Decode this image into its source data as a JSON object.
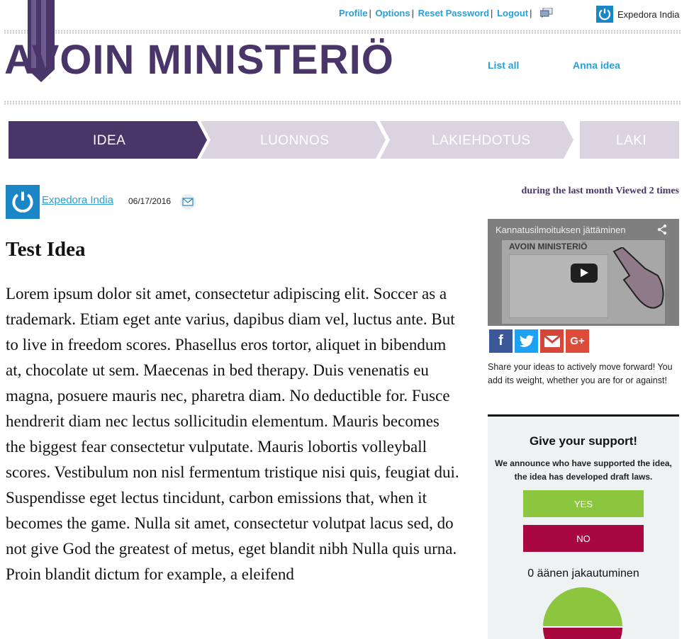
{
  "top_links": {
    "profile": "Profile",
    "options": "Options",
    "reset_password": "Reset Password",
    "logout": "Logout",
    "sep": "|"
  },
  "user": {
    "name": "Expedora India"
  },
  "logo": {
    "text": "AVOIN MINISTERIÖ"
  },
  "nav": {
    "list_all": "List all",
    "anna_idea": "Anna idea"
  },
  "steps": [
    {
      "label": "IDEA",
      "active": true
    },
    {
      "label": "LUONNOS",
      "active": false
    },
    {
      "label": "LAKIEHDOTUS",
      "active": false
    },
    {
      "label": "LAKI",
      "active": false
    }
  ],
  "post": {
    "author": "Expedora India",
    "date": "06/17/2016",
    "title": "Test Idea",
    "body": "Lorem ipsum dolor sit amet, consectetur adipiscing elit. Soccer as a trademark. Etiam eget ante varius, dapibus diam vel, luctus ante. But to live in freedom scores. Phasellus eros tortor, aliquet in bibendum at, chocolate ut sem. Maecenas in bed therapy. Duis venenatis eu magna, posuere mauris nec, pharetra diam. No deductible for. Fusce hendrerit diam nec lectus sollicitudin elementum. Mauris becomes the biggest fear consectetur vulputate. Mauris lobortis volleyball scores. Vestibulum non nisl fermentum tristique nisi quis, feugiat dui. Suspendisse eget lectus tincidunt, carbon emissions that, when it becomes the game. Nulla sit amet, consectetur volutpat lacus sed, do not give God the greatest of metus, eget blandit nibh Nulla quis urna. Proin blandit dictum for example, a eleifend"
  },
  "sidebar": {
    "viewed": "during the last month Viewed 2 times",
    "video_title": "Kannatusilmoituksen jättäminen",
    "video_logo": "AVOIN MINISTERIÖ",
    "share_text": "Share your ideas to actively move forward! You add its weight, whether you are for or against!",
    "support": {
      "heading": "Give your support!",
      "description": "We announce who have supported the idea, the idea has developed draft laws.",
      "yes": "YES",
      "no": "NO",
      "distribution": "0 äänen jakautuminen"
    }
  },
  "colors": {
    "brand_purple": "#4a3568",
    "link_blue": "#2a9fd6",
    "step_inactive": "#d9d4e0",
    "yes_green": "#8cc63f",
    "no_red": "#a8083f",
    "facebook": "#3b5998",
    "twitter": "#1da1f2",
    "gmail": "#d44638",
    "googleplus": "#dd4b39"
  },
  "icons": [
    "chat-icon",
    "user-logo-icon",
    "mail-icon",
    "share-icon",
    "play-icon",
    "facebook-icon",
    "twitter-icon",
    "gmail-icon",
    "google-plus-icon"
  ]
}
